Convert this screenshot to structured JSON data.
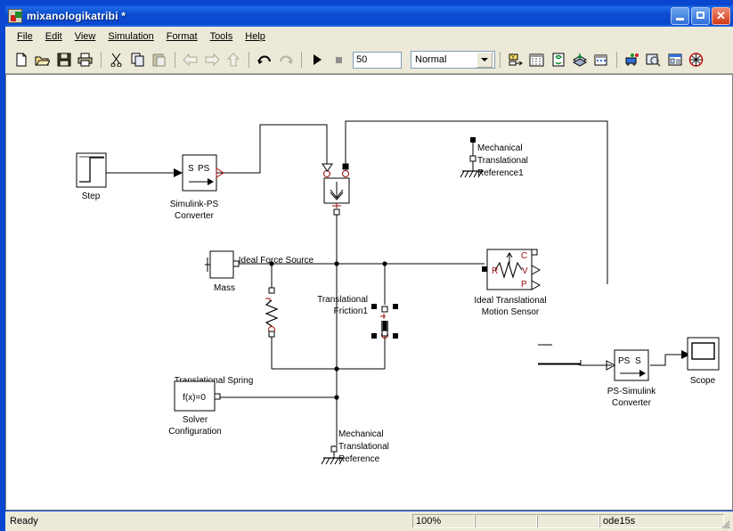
{
  "window": {
    "title": "mixanologikatribi *",
    "icon": "simulink-model-icon",
    "buttons": {
      "minimize": "minimize",
      "maximize": "maximize",
      "close": "close"
    }
  },
  "menu": [
    {
      "label": "File",
      "accel": "F"
    },
    {
      "label": "Edit",
      "accel": "E"
    },
    {
      "label": "View",
      "accel": "V"
    },
    {
      "label": "Simulation",
      "accel": "S"
    },
    {
      "label": "Format",
      "accel": "F"
    },
    {
      "label": "Tools",
      "accel": "T"
    },
    {
      "label": "Help",
      "accel": "H"
    }
  ],
  "toolbar": {
    "buttons": [
      {
        "name": "new-model-icon",
        "tip": "New model"
      },
      {
        "name": "open-model-icon",
        "tip": "Open model"
      },
      {
        "name": "save-icon",
        "tip": "Save"
      },
      {
        "name": "print-icon",
        "tip": "Print"
      },
      {
        "name": "cut-icon",
        "tip": "Cut"
      },
      {
        "name": "copy-icon",
        "tip": "Copy"
      },
      {
        "name": "paste-icon",
        "tip": "Paste"
      },
      {
        "name": "back-icon",
        "tip": "Back"
      },
      {
        "name": "forward-icon",
        "tip": "Forward"
      },
      {
        "name": "up-level-icon",
        "tip": "Go to parent"
      },
      {
        "name": "undo-icon",
        "tip": "Undo"
      },
      {
        "name": "redo-icon",
        "tip": "Redo"
      },
      {
        "name": "start-simulation-icon",
        "tip": "Start simulation"
      },
      {
        "name": "stop-simulation-icon",
        "tip": "Stop simulation"
      },
      {
        "name": "build-model-icon",
        "tip": "Build model"
      },
      {
        "name": "debug-icon",
        "tip": "Debug"
      },
      {
        "name": "update-diagram-icon",
        "tip": "Update diagram"
      },
      {
        "name": "library-browser-icon",
        "tip": "Library Browser"
      },
      {
        "name": "toggle-model-browser-icon",
        "tip": "Model browser"
      },
      {
        "name": "model-explorer-icon",
        "tip": "Model Explorer"
      },
      {
        "name": "model-advisor-icon",
        "tip": "Model Advisor"
      },
      {
        "name": "block-parameters-icon",
        "tip": "Block parameters"
      },
      {
        "name": "stop-time-icon",
        "tip": "Stop"
      }
    ],
    "simulation_time": "50",
    "simulation_mode": "Normal"
  },
  "statusbar": {
    "status": "Ready",
    "zoom": "100%",
    "field_a": "",
    "field_b": "",
    "solver": "ode15s"
  },
  "diagram": {
    "blocks": [
      {
        "id": "step",
        "label": "Step",
        "type": "step-block"
      },
      {
        "id": "simulink_ps",
        "label": "Simulink-PS\nConverter",
        "label_line1": "Simulink-PS",
        "label_line2": "Converter",
        "symbol_left": "S",
        "symbol_right": "PS",
        "type": "simulink-ps-converter-block"
      },
      {
        "id": "force_source",
        "label": "Ideal Force Source",
        "type": "ideal-force-source-block"
      },
      {
        "id": "ref1",
        "label_line1": "Mechanical",
        "label_line2": "Translational",
        "label_line3": "Reference1",
        "type": "mechanical-translational-reference-block"
      },
      {
        "id": "mass",
        "label": "Mass",
        "type": "mass-block"
      },
      {
        "id": "spring",
        "label": "Translational Spring",
        "type": "translational-spring-block"
      },
      {
        "id": "friction",
        "label_line1": "Translational",
        "label_line2": "Friction1",
        "type": "translational-friction-block",
        "selected": true
      },
      {
        "id": "sensor",
        "label_line1": "Ideal Translational",
        "label_line2": "Motion Sensor",
        "port_r": "R",
        "port_c": "C",
        "port_v": "V",
        "port_p": "P",
        "type": "ideal-translational-motion-sensor-block"
      },
      {
        "id": "ps_simulink",
        "label_line1": "PS-Simulink",
        "label_line2": "Converter",
        "symbol_left": "PS",
        "symbol_right": "S",
        "type": "ps-simulink-converter-block"
      },
      {
        "id": "scope",
        "label": "Scope",
        "type": "scope-block"
      },
      {
        "id": "solver",
        "label_line1": "Solver",
        "label_line2": "Configuration",
        "symbol": "f(x)=0",
        "type": "solver-configuration-block"
      },
      {
        "id": "ref0",
        "label_line1": "Mechanical",
        "label_line2": "Translational",
        "label_line3": "Reference",
        "type": "mechanical-translational-reference-block"
      }
    ],
    "colors": {
      "wire": "#000000",
      "port_physical": "#9e0b0b",
      "block_outline": "#000000",
      "selection_handle": "#000000",
      "canvas_bg": "#ffffff"
    }
  }
}
